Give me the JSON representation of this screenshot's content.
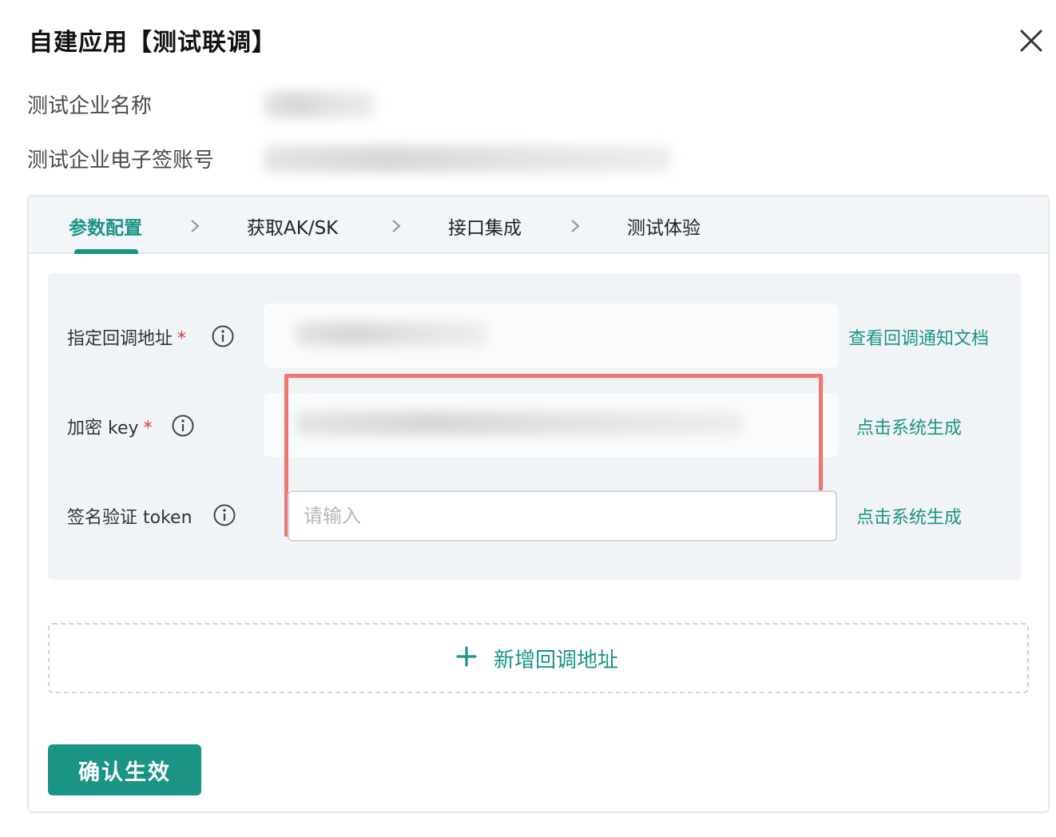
{
  "dialog": {
    "title": "自建应用【测试联调】"
  },
  "info": {
    "company_name_label": "测试企业名称",
    "company_account_label": "测试企业电子签账号"
  },
  "steps": [
    {
      "label": "参数配置",
      "active": true
    },
    {
      "label": "获取AK/SK",
      "active": false
    },
    {
      "label": "接口集成",
      "active": false
    },
    {
      "label": "测试体验",
      "active": false
    }
  ],
  "form": {
    "callback_url": {
      "label": "指定回调地址",
      "required_mark": "*",
      "action": "查看回调通知文档"
    },
    "encrypt_key": {
      "label": "加密 key",
      "required_mark": "*",
      "action": "点击系统生成"
    },
    "sign_token": {
      "label": "签名验证 token",
      "placeholder": "请输入",
      "action": "点击系统生成"
    }
  },
  "add_callback": {
    "label": "新增回调地址"
  },
  "confirm_button": {
    "label": "确认生效"
  },
  "colors": {
    "accent": "#1a9484",
    "highlight": "#f07471",
    "required": "#d9363e"
  }
}
